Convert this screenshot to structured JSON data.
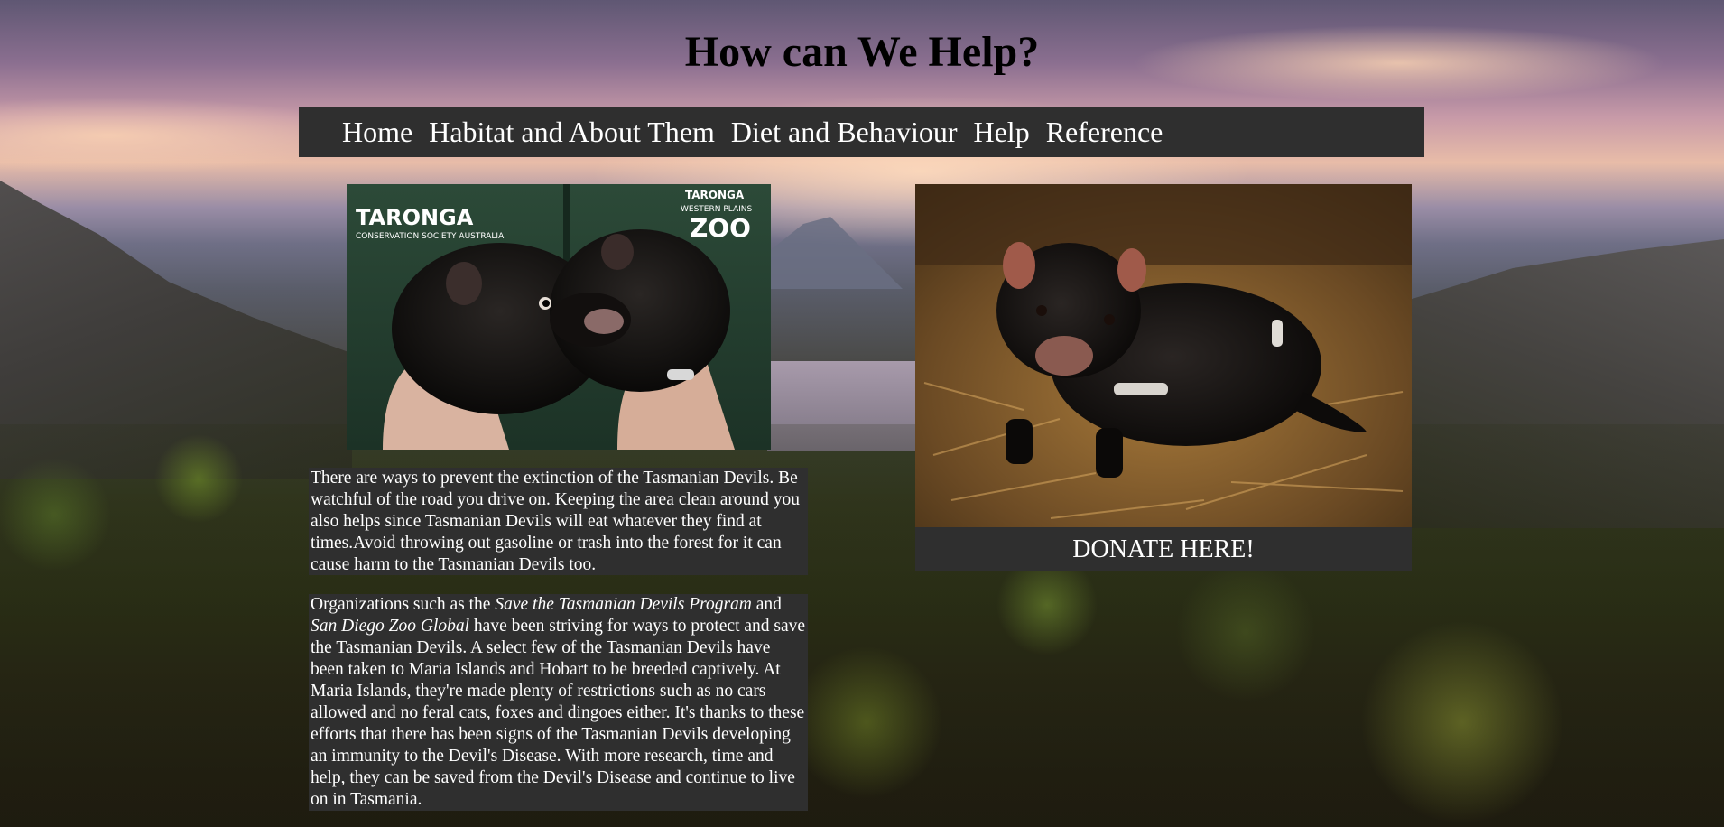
{
  "page": {
    "title": "How can We Help?"
  },
  "nav": {
    "items": [
      {
        "label": "Home"
      },
      {
        "label": "Habitat and About Them"
      },
      {
        "label": "Diet and Behaviour"
      },
      {
        "label": "Help"
      },
      {
        "label": "Reference"
      }
    ]
  },
  "photos": {
    "left": {
      "alt": "Taronga Zoo staff holding two Tasmanian devil joeys",
      "logo_text": "TARONGA",
      "logo_sub": "CONSERVATION SOCIETY AUSTRALIA",
      "patch_top": "TARONGA",
      "patch_mid": "WESTERN PLAINS",
      "patch_big": "ZOO"
    },
    "right": {
      "alt": "Young Tasmanian devil standing on straw"
    }
  },
  "content": {
    "paragraph1": "There are ways to prevent the extinction of the Tasmanian Devils. Be watchful of the road you drive on. Keeping the area clean around you also helps since Tasmanian Devils will eat whatever they find at times.Avoid throwing out gasoline or trash into the forest for it can cause harm to the Tasmanian Devils too.",
    "paragraph2": {
      "part1": "Organizations such as the ",
      "italic1": "Save the Tasmanian Devils Program",
      "part2": " and ",
      "italic2": "San Diego Zoo Global",
      "part3": " have been striving for ways to protect and save the Tasmanian Devils. A select few of the Tasmanian Devils have been taken to Maria Islands and Hobart to be breeded captively. At Maria Islands, they're made plenty of restrictions such as no cars allowed and no feral cats, foxes and dingoes either. It's thanks to these efforts that there has been signs of the Tasmanian Devils developing an immunity to the Devil's Disease. With more research, time and help, they can be saved from the Devil's Disease and continue to live on in Tasmania."
    }
  },
  "donate": {
    "label": "DONATE HERE!"
  },
  "colors": {
    "panel": "#2f2f2f",
    "text_light": "#ffffff",
    "title": "#000000"
  }
}
